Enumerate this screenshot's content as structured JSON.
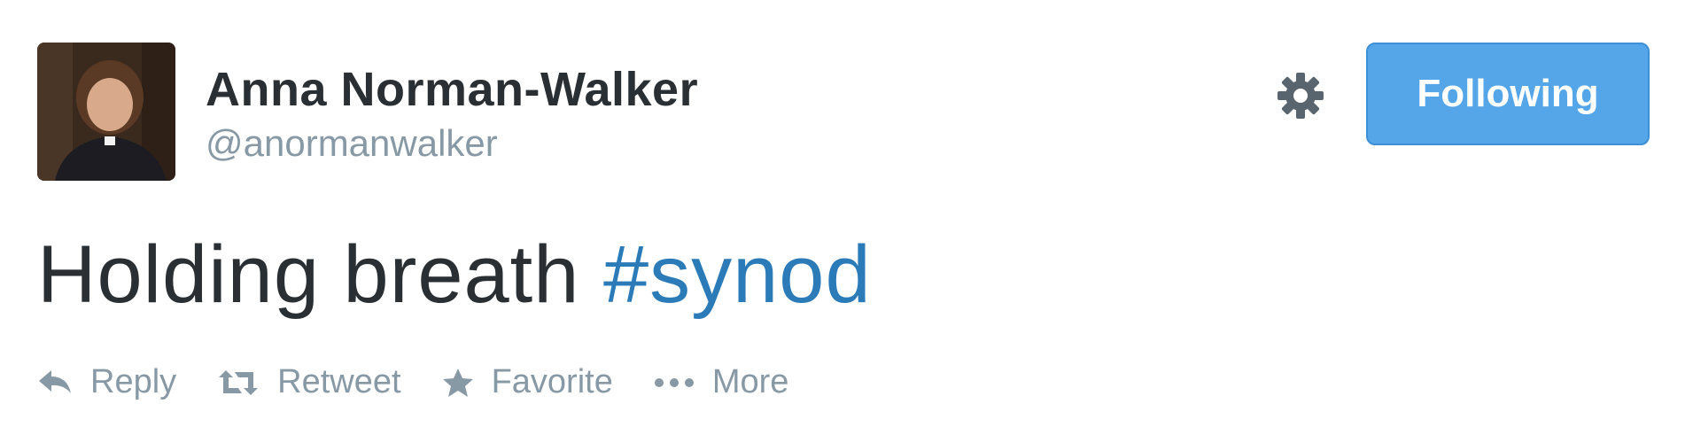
{
  "user": {
    "name": "Anna Norman-Walker",
    "handle": "@anormanwalker"
  },
  "follow_button": {
    "label": "Following"
  },
  "tweet": {
    "text": "Holding breath ",
    "hashtag": "#synod"
  },
  "actions": {
    "reply": "Reply",
    "retweet": "Retweet",
    "favorite": "Favorite",
    "more": "More"
  },
  "icons": {
    "settings": "gear-icon",
    "reply": "reply-icon",
    "retweet": "retweet-icon",
    "favorite": "star-icon",
    "more": "ellipsis-icon"
  },
  "colors": {
    "follow_button": "#55a6e8",
    "hashtag": "#2b7bb9",
    "muted": "#8899a6",
    "text": "#292f33"
  }
}
